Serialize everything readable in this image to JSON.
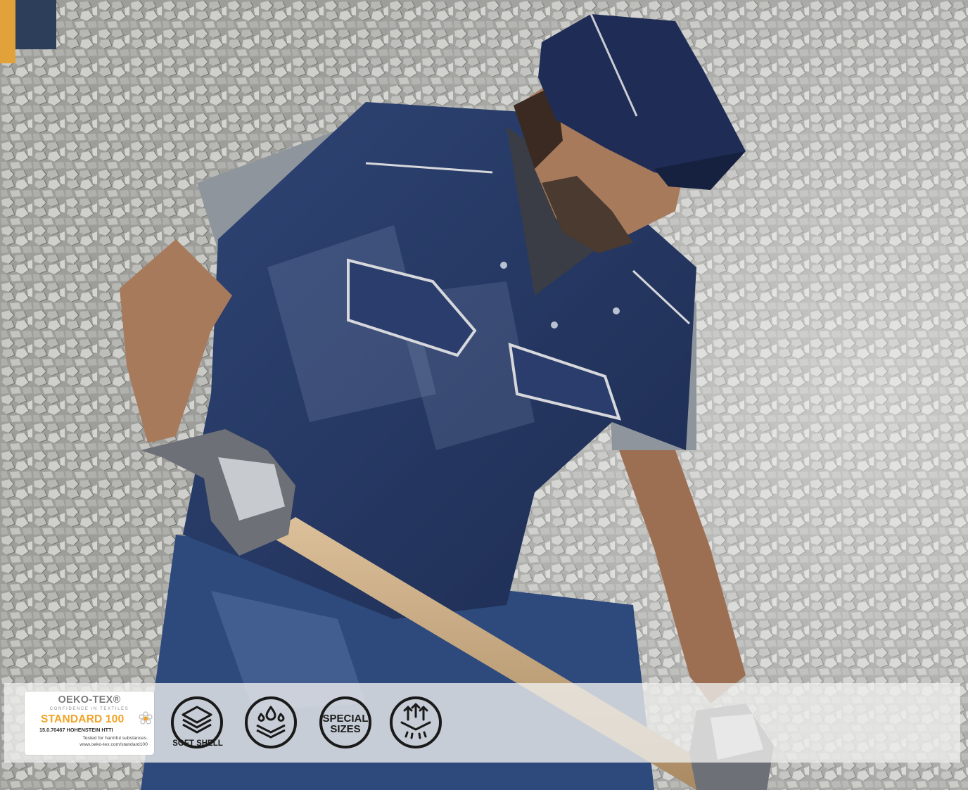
{
  "photo": {
    "subject": "Worker in navy work vest and cap shoveling gravel",
    "colors": {
      "gravel": "#a6a6a3",
      "vest": "#263a66",
      "cap": "#1f2c55",
      "shirt": "#8f959c",
      "skin": "#a87a5c",
      "handle": "#c9aa82",
      "glove": "#6d7076"
    }
  },
  "badge": {
    "title": "OEKO-TEX®",
    "tagline": "CONFIDENCE IN TEXTILES",
    "standard": "STANDARD 100",
    "code": "15.0.70467 HOHENSTEIN HTTI",
    "note_line1": "Tested for harmful substances.",
    "note_line2": "www.oeko-tex.com/standard100",
    "accent": "#f3a324"
  },
  "features": [
    {
      "icon": "soft-shell-layers-icon",
      "label": "SOFT SHELL"
    },
    {
      "icon": "water-repellent-icon",
      "label": ""
    },
    {
      "icon": "special-sizes-icon",
      "label_line1": "SPECIAL",
      "label_line2": "SIZES"
    },
    {
      "icon": "breathable-icon",
      "label": ""
    }
  ]
}
